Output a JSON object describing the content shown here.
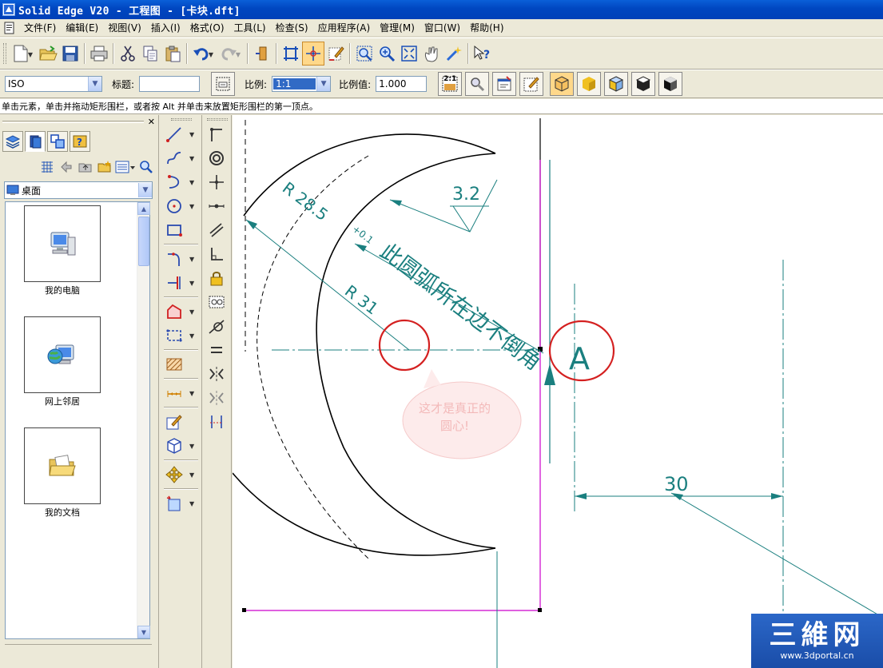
{
  "window": {
    "title": "Solid Edge V20 - 工程图 - [卡块.dft]"
  },
  "menu": {
    "items": [
      "文件(F)",
      "编辑(E)",
      "视图(V)",
      "插入(I)",
      "格式(O)",
      "工具(L)",
      "检查(S)",
      "应用程序(A)",
      "管理(M)",
      "窗口(W)",
      "帮助(H)"
    ]
  },
  "toolbar2": {
    "standard_value": "ISO",
    "title_label": "标题:",
    "title_value": "",
    "scale_label": "比例:",
    "scale_value": "1:1",
    "scale_value_label": "比例值:",
    "scale_number": "1.000",
    "scale_btn_text": "2:1"
  },
  "status": {
    "text": "单击元素，单击并拖动矩形围栏，或者按 Alt 并单击来放置矩形围栏的第一顶点。"
  },
  "library": {
    "location": "桌面",
    "items": [
      {
        "label": "我的电脑",
        "icon": "computer-icon"
      },
      {
        "label": "网上邻居",
        "icon": "network-icon"
      },
      {
        "label": "我的文档",
        "icon": "documents-icon"
      }
    ]
  },
  "drawing": {
    "dim_r28": "R 28.5",
    "dim_r31": "R 31",
    "dim_tol": "+0.1",
    "surface_finish": "3.2",
    "note": "此圆弧所在边不倒角",
    "datum": "A",
    "dim_30": "30",
    "callout": "这才是真正的圆心!",
    "colors": {
      "dimension": "#1a7f7f",
      "sheet_border": "#cc00cc",
      "highlight": "#d42020"
    }
  },
  "watermark": {
    "logo": "三維网",
    "url": "www.3dportal.cn"
  }
}
